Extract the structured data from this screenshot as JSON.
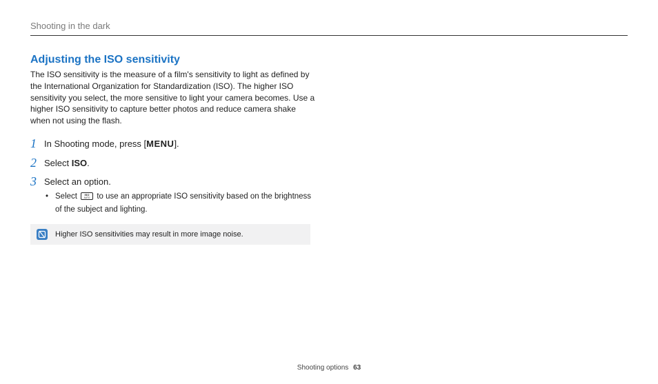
{
  "header": {
    "breadcrumb": "Shooting in the dark"
  },
  "section": {
    "title": "Adjusting the ISO sensitivity",
    "intro": "The ISO sensitivity is the measure of a film's sensitivity to light as defined by the International Organization for Standardization (ISO). The higher ISO sensitivity you select, the more sensitive to light your camera becomes. Use a higher ISO sensitivity to capture better photos and reduce camera shake when not using the flash."
  },
  "steps": {
    "s1": {
      "num": "1",
      "pre": "In Shooting mode, press [",
      "btn": "MENU",
      "post": "]."
    },
    "s2": {
      "num": "2",
      "pre": "Select ",
      "bold": "ISO",
      "post": "."
    },
    "s3": {
      "num": "3",
      "text": "Select an option.",
      "sub_pre": "Select ",
      "sub_post": " to use an appropriate ISO sensitivity based on the brightness of the subject and lighting."
    }
  },
  "note": {
    "text": "Higher ISO sensitivities may result in more image noise."
  },
  "footer": {
    "section": "Shooting options",
    "page": "63"
  }
}
